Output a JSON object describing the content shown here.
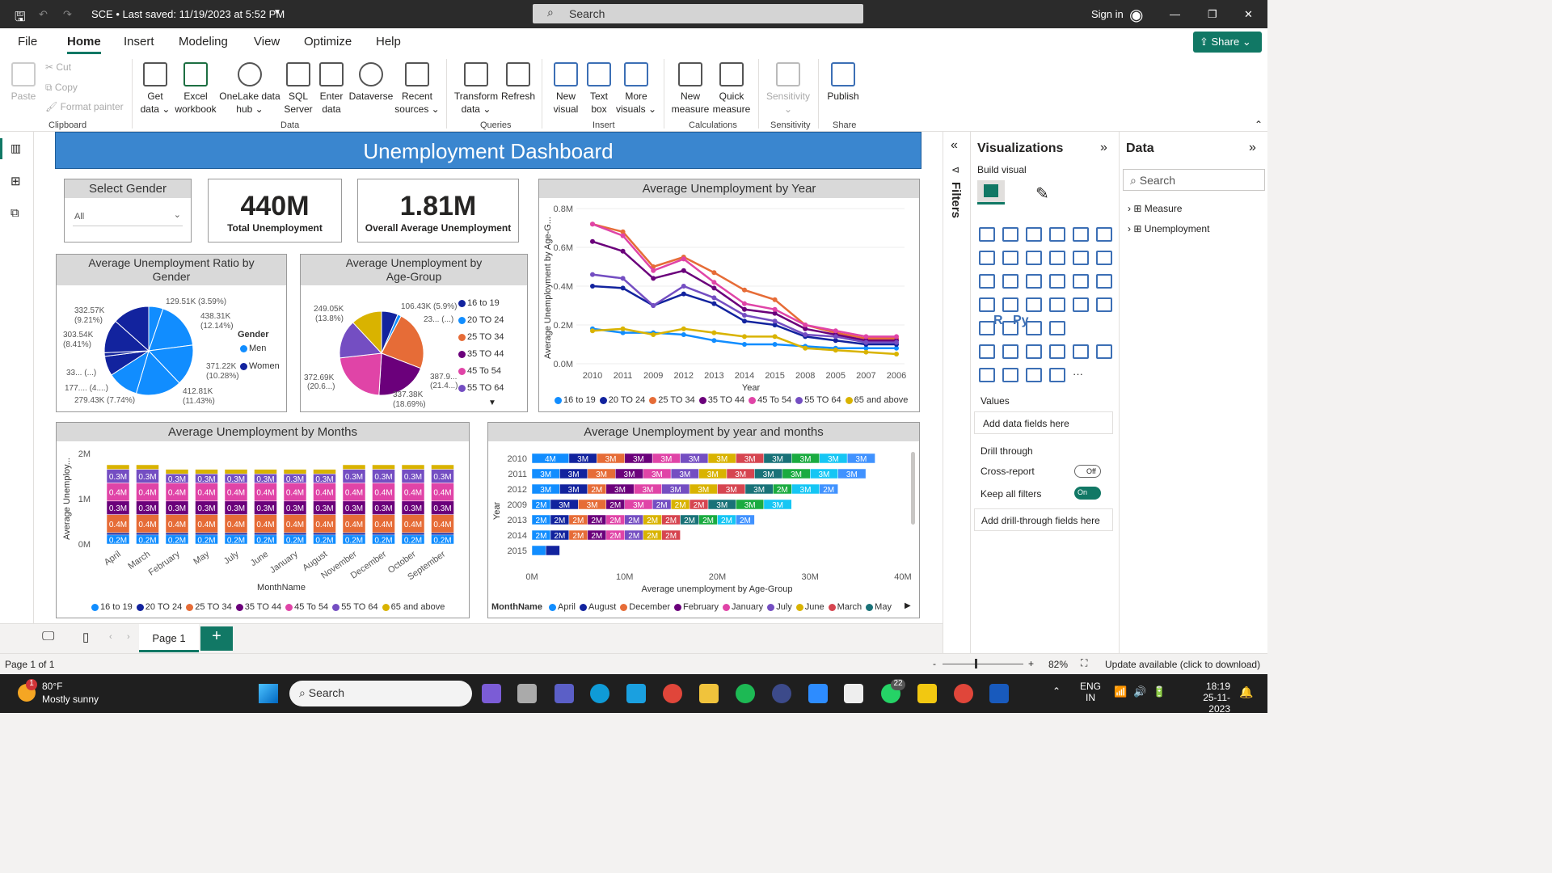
{
  "app": {
    "title": "SCE • Last saved: 11/19/2023 at 5:52 PM",
    "search": "Search",
    "signin": "Sign in",
    "share": "Share"
  },
  "menu": [
    "File",
    "Home",
    "Insert",
    "Modeling",
    "View",
    "Optimize",
    "Help"
  ],
  "ribbon": {
    "clipboard": {
      "paste": "Paste",
      "cut": "Cut",
      "copy": "Copy",
      "format": "Format painter",
      "group": "Clipboard"
    },
    "data_items": [
      {
        "l1": "Get",
        "l2": "data ⌄"
      },
      {
        "l1": "Excel",
        "l2": "workbook"
      },
      {
        "l1": "OneLake data",
        "l2": "hub ⌄"
      },
      {
        "l1": "SQL",
        "l2": "Server"
      },
      {
        "l1": "Enter",
        "l2": "data"
      },
      {
        "l1": "Dataverse",
        "l2": ""
      },
      {
        "l1": "Recent",
        "l2": "sources ⌄"
      }
    ],
    "groups": {
      "data": "Data",
      "queries": "Queries",
      "insert": "Insert",
      "calculations": "Calculations",
      "sensitivity": "Sensitivity",
      "share": "Share"
    },
    "queries": [
      {
        "l1": "Transform",
        "l2": "data ⌄"
      },
      {
        "l1": "Refresh",
        "l2": ""
      }
    ],
    "insert": [
      {
        "l1": "New",
        "l2": "visual"
      },
      {
        "l1": "Text",
        "l2": "box"
      },
      {
        "l1": "More",
        "l2": "visuals ⌄"
      }
    ],
    "calc": [
      {
        "l1": "New",
        "l2": "measure"
      },
      {
        "l1": "Quick",
        "l2": "measure"
      }
    ],
    "sens": {
      "l1": "Sensitivity",
      "l2": "⌄"
    },
    "publish": "Publish"
  },
  "dashboard": {
    "title": "Unemployment Dashboard",
    "slicer": {
      "title": "Select Gender",
      "value": "All"
    },
    "kpi1": {
      "value": "440M",
      "label": "Total Unemployment"
    },
    "kpi2": {
      "value": "1.81M",
      "label": "Overall Average Unemployment"
    },
    "pie1": {
      "title": "Average Unemployment Ratio by Gender",
      "legend_title": "Gender",
      "legend": [
        "Men",
        "Women"
      ],
      "labels": [
        "129.51K (3.59%)",
        "438.31K",
        "(12.14%)",
        "371.22K",
        "(10.28%)",
        "412.81K",
        "(11.43%)",
        "279.43K (7.74%)",
        "177.... (4....)",
        "33... (...)",
        "303.54K",
        "(8.41%)",
        "332.57K",
        "(9.21%)"
      ]
    },
    "pie2": {
      "title": "Average Unemployment by Age-Group",
      "legend": [
        "16 to 19",
        "20 TO 24",
        "25 TO 34",
        "35 TO 44",
        "45 To 54",
        "55 TO 64"
      ],
      "labels": [
        "106.43K (5.9%)",
        "23... (...)",
        "387.9...",
        "(21.4...)",
        "337.38K",
        "(18.69%)",
        "372.69K",
        "(20.6...)",
        "249.05K",
        "(13.8%)"
      ]
    },
    "line": {
      "title": "Average Unemployment by Year",
      "xlabel": "Year",
      "ylabel": "Average Unemployment by Age-G...",
      "legend": [
        "16 to 19",
        "20 TO 24",
        "25 TO 34",
        "35 TO 44",
        "45 To 54",
        "55 TO 64",
        "65 and above"
      ]
    },
    "bar1": {
      "title": "Average Unemployment by Months",
      "xlabel": "MonthName",
      "ylabel": "Average Unemploy...",
      "legend": [
        "16 to 19",
        "20 TO 24",
        "25 TO 34",
        "35 TO 44",
        "45 To 54",
        "55 TO 64",
        "65 and above"
      ]
    },
    "bar2": {
      "title": "Average Unemployment by year and months",
      "xlabel": "Average unemployment by Age-Group",
      "ylabel": "Year",
      "legend_title": "MonthName",
      "legend": [
        "April",
        "August",
        "December",
        "February",
        "January",
        "July",
        "June",
        "March",
        "May"
      ]
    }
  },
  "chart_data": [
    {
      "type": "pie",
      "title": "Average Unemployment Ratio by Gender",
      "values": [
        129.51,
        438.31,
        371.22,
        412.81,
        279.43,
        177,
        33,
        303.54,
        332.57
      ],
      "colors": [
        "#118dff",
        "#118dff",
        "#118dff",
        "#118dff",
        "#118dff",
        "#12239e",
        "#12239e",
        "#12239e",
        "#12239e"
      ],
      "legend": [
        "Men",
        "Women"
      ]
    },
    {
      "type": "pie",
      "title": "Average Unemployment by Age-Group",
      "values": [
        106.43,
        23,
        387.9,
        337.38,
        372.69,
        249.05
      ],
      "colors": [
        "#12239e",
        "#118dff",
        "#e66c37",
        "#6b007b",
        "#e044a7",
        "#744ec2",
        "#d9b300"
      ],
      "legend": [
        "16 to 19",
        "20 TO 24",
        "25 TO 34",
        "35 TO 44",
        "45 To 54",
        "55 TO 64"
      ]
    },
    {
      "type": "line",
      "title": "Average Unemployment by Year",
      "x": [
        "2010",
        "2011",
        "2009",
        "2012",
        "2013",
        "2014",
        "2015",
        "2008",
        "2005",
        "2007",
        "2006"
      ],
      "ylim": [
        0,
        0.8
      ],
      "yticks": [
        "0.0M",
        "0.2M",
        "0.4M",
        "0.6M",
        "0.8M"
      ],
      "series": [
        {
          "name": "16 to 19",
          "color": "#118dff",
          "values": [
            0.18,
            0.16,
            0.16,
            0.15,
            0.12,
            0.1,
            0.1,
            0.09,
            0.08,
            0.08,
            0.08
          ]
        },
        {
          "name": "20 TO 24",
          "color": "#12239e",
          "values": [
            0.4,
            0.39,
            0.3,
            0.36,
            0.31,
            0.22,
            0.2,
            0.14,
            0.12,
            0.1,
            0.1
          ]
        },
        {
          "name": "25 TO 34",
          "color": "#e66c37",
          "values": [
            0.72,
            0.68,
            0.5,
            0.55,
            0.47,
            0.38,
            0.33,
            0.2,
            0.16,
            0.13,
            0.13
          ]
        },
        {
          "name": "35 TO 44",
          "color": "#6b007b",
          "values": [
            0.63,
            0.58,
            0.44,
            0.48,
            0.39,
            0.28,
            0.26,
            0.18,
            0.15,
            0.12,
            0.12
          ]
        },
        {
          "name": "45 To 54",
          "color": "#e044a7",
          "values": [
            0.72,
            0.66,
            0.48,
            0.54,
            0.42,
            0.31,
            0.28,
            0.2,
            0.17,
            0.14,
            0.14
          ]
        },
        {
          "name": "55 TO 64",
          "color": "#744ec2",
          "values": [
            0.46,
            0.44,
            0.3,
            0.4,
            0.34,
            0.25,
            0.22,
            0.15,
            0.14,
            0.11,
            0.11
          ]
        },
        {
          "name": "65 and above",
          "color": "#d9b300",
          "values": [
            0.17,
            0.18,
            0.15,
            0.18,
            0.16,
            0.14,
            0.14,
            0.08,
            0.07,
            0.06,
            0.05
          ]
        }
      ]
    },
    {
      "type": "bar",
      "title": "Average Unemployment by Months",
      "categories": [
        "April",
        "March",
        "February",
        "May",
        "July",
        "June",
        "January",
        "August",
        "November",
        "December",
        "October",
        "September"
      ],
      "ylim": [
        0,
        2
      ],
      "yticks": [
        "0M",
        "1M",
        "2M"
      ],
      "series": [
        {
          "name": "16 to 19",
          "color": "#118dff",
          "values": [
            0.2,
            0.2,
            0.2,
            0.2,
            0.2,
            0.2,
            0.2,
            0.2,
            0.2,
            0.2,
            0.2,
            0.2
          ],
          "label": "0.2M"
        },
        {
          "name": "20 TO 24",
          "color": "#12239e",
          "values": [
            0.05,
            0.05,
            0.05,
            0.05,
            0.05,
            0.05,
            0.05,
            0.05,
            0.05,
            0.05,
            0.05,
            0.05
          ],
          "label": ""
        },
        {
          "name": "25 TO 34",
          "color": "#e66c37",
          "values": [
            0.4,
            0.4,
            0.4,
            0.4,
            0.4,
            0.4,
            0.4,
            0.4,
            0.4,
            0.4,
            0.4,
            0.4
          ],
          "label": "0.4M"
        },
        {
          "name": "35 TO 44",
          "color": "#6b007b",
          "values": [
            0.3,
            0.3,
            0.3,
            0.3,
            0.3,
            0.3,
            0.3,
            0.3,
            0.3,
            0.3,
            0.3,
            0.3
          ],
          "label": "0.3M"
        },
        {
          "name": "45 To 54",
          "color": "#e044a7",
          "values": [
            0.4,
            0.4,
            0.4,
            0.4,
            0.4,
            0.4,
            0.4,
            0.4,
            0.4,
            0.4,
            0.4,
            0.4
          ],
          "label": "0.4M"
        },
        {
          "name": "55 TO 64",
          "color": "#744ec2",
          "values": [
            0.3,
            0.3,
            0.2,
            0.2,
            0.2,
            0.2,
            0.2,
            0.2,
            0.3,
            0.3,
            0.3,
            0.3
          ],
          "label": "0.3M"
        },
        {
          "name": "65 and above",
          "color": "#d9b300",
          "values": [
            0.1,
            0.1,
            0.1,
            0.1,
            0.1,
            0.1,
            0.1,
            0.1,
            0.1,
            0.1,
            0.1,
            0.1
          ],
          "label": ""
        }
      ]
    },
    {
      "type": "bar",
      "title": "Average Unemployment by year and months",
      "categories": [
        "2010",
        "2011",
        "2012",
        "2009",
        "2013",
        "2014",
        "2015"
      ],
      "xlim": [
        0,
        40
      ],
      "xticks": [
        "0M",
        "10M",
        "20M",
        "30M",
        "40M"
      ],
      "rows": [
        {
          "year": "2010",
          "segs": [
            "4M",
            "3M",
            "3M",
            "3M",
            "3M",
            "3M",
            "3M",
            "3M",
            "3M",
            "3M",
            "3M",
            "3M"
          ]
        },
        {
          "year": "2011",
          "segs": [
            "3M",
            "3M",
            "3M",
            "3M",
            "3M",
            "3M",
            "3M",
            "3M",
            "3M",
            "3M",
            "3M",
            "3M"
          ]
        },
        {
          "year": "2012",
          "segs": [
            "3M",
            "3M",
            "2M",
            "3M",
            "3M",
            "3M",
            "3M",
            "3M",
            "3M",
            "2M",
            "3M",
            "2M"
          ]
        },
        {
          "year": "2009",
          "segs": [
            "2M",
            "3M",
            "3M",
            "2M",
            "3M",
            "2M",
            "2M",
            "2M",
            "3M",
            "3M",
            "3M"
          ]
        },
        {
          "year": "2013",
          "segs": [
            "2M",
            "2M",
            "2M",
            "2M",
            "2M",
            "2M",
            "2M",
            "2M",
            "2M",
            "2M",
            "2M",
            "2M"
          ]
        },
        {
          "year": "2014",
          "segs": [
            "2M",
            "2M",
            "2M",
            "2M",
            "2M",
            "2M",
            "2M",
            "2M"
          ]
        },
        {
          "year": "2015",
          "segs": [
            "",
            ""
          ]
        }
      ],
      "palette": [
        "#118dff",
        "#12239e",
        "#e66c37",
        "#6b007b",
        "#e044a7",
        "#744ec2",
        "#d9b300",
        "#d64550",
        "#197278",
        "#1aab40",
        "#15c6f4",
        "#4092ff"
      ]
    }
  ],
  "viz_panel": {
    "title": "Visualizations",
    "build": "Build visual",
    "values": "Values",
    "add_fields": "Add data fields here",
    "drill": "Drill through",
    "cross": "Cross-report",
    "cross_state": "Off",
    "keep": "Keep all filters",
    "keep_state": "On",
    "add_drill": "Add drill-through fields here",
    "r": "R",
    "py": "Py"
  },
  "filters_label": "Filters",
  "data_panel": {
    "title": "Data",
    "search": "Search",
    "items": [
      "Measure",
      "Unemployment"
    ]
  },
  "pages": {
    "tab": "Page 1",
    "add": "+"
  },
  "status": {
    "page": "Page 1 of 1",
    "zoom": "82%",
    "update": "Update available (click to download)"
  },
  "taskbar": {
    "temp": "80°F",
    "weather": "Mostly sunny",
    "search": "Search",
    "lang1": "ENG",
    "lang2": "IN",
    "time": "18:19",
    "date": "25-11-2023",
    "badge": "22",
    "alert": "1"
  }
}
